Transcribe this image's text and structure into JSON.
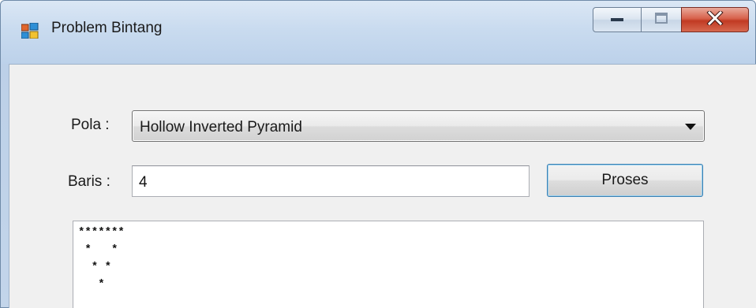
{
  "window": {
    "title": "Problem Bintang",
    "app_icon": "windows-forms-app-icon",
    "caption_buttons": [
      "minimize",
      "maximize",
      "close"
    ]
  },
  "form": {
    "pola_label": "Pola :",
    "pola_selected": "Hollow Inverted Pyramid",
    "baris_label": "Baris :",
    "baris_value": "4",
    "proses_label": "Proses"
  },
  "output": {
    "lines": [
      "*******",
      " *   *",
      "  * *",
      "   *"
    ]
  },
  "colors": {
    "title_bar": "#c9dbef",
    "client_bg": "#f0f0f0",
    "close_button": "#c13a23",
    "focus_border": "#3c7fb1"
  }
}
